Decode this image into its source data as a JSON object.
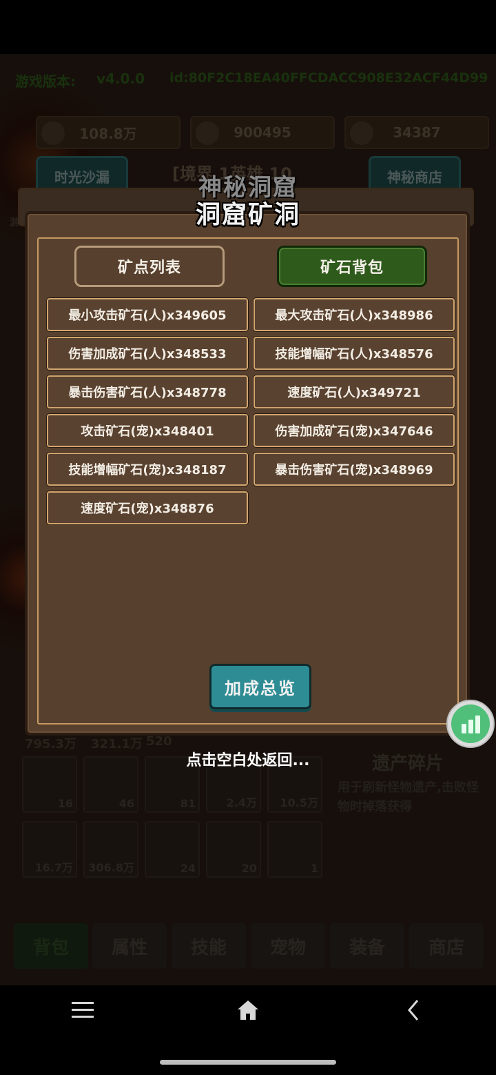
{
  "background": {
    "version_label": "游戏版本:",
    "version_value": "v4.0.0",
    "device_id": "id:80F2C18EA40FFCDACC908E32ACF44D99",
    "resources": [
      "108.8万",
      "900495",
      "34387"
    ],
    "left_button": "时光沙漏",
    "right_button": "神秘商店",
    "realm": "[境界 1英雄 10",
    "side_label": "游",
    "relic_title": "遗产碎片",
    "relic_desc": "用于刷新怪物遗产,击败怪物时掉落获得",
    "partial_counts": [
      "795.3万",
      "321.1万",
      "520"
    ],
    "inventory_counts": [
      "16",
      "46",
      "81",
      "2.4万",
      "10.5万",
      "16.7万",
      "306.8万",
      "24",
      "20",
      "1"
    ],
    "bottom_tabs": [
      "背包",
      "属性",
      "技能",
      "宠物",
      "装备",
      "商店"
    ]
  },
  "dialog": {
    "subtitle": "神秘洞窟",
    "title": "洞窟矿洞",
    "tab_list": "矿点列表",
    "tab_bag": "矿石背包",
    "ores": [
      "最小攻击矿石(人)x349605",
      "最大攻击矿石(人)x348986",
      "伤害加成矿石(人)x348533",
      "技能增幅矿石(人)x348576",
      "暴击伤害矿石(人)x348778",
      "速度矿石(人)x349721",
      "攻击矿石(宠)x348401",
      "伤害加成矿石(宠)x347646",
      "技能增幅矿石(宠)x348187",
      "暴击伤害矿石(宠)x348969",
      "速度矿石(宠)x348876"
    ],
    "summary_button": "加成总览",
    "hint": "点击空白处返回..."
  },
  "colors": {
    "dialog_bg": "#57402d",
    "active_tab": "#2e5a1c",
    "summary_button": "#2e8c94",
    "ore_border": "#d2a670"
  },
  "icons": {
    "stats": "bar-chart-icon",
    "nav_menu": "menu-icon",
    "nav_home": "home-icon",
    "nav_back": "back-icon"
  }
}
